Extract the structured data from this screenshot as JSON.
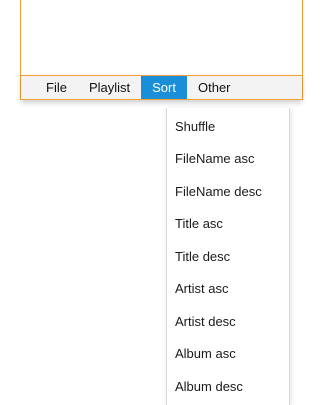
{
  "menubar": {
    "items": [
      {
        "label": "File"
      },
      {
        "label": "Playlist"
      },
      {
        "label": "Sort"
      },
      {
        "label": "Other"
      }
    ],
    "active_index": 2
  },
  "sort_menu": {
    "items": [
      {
        "label": "Shuffle"
      },
      {
        "label": "FileName asc"
      },
      {
        "label": "FileName desc"
      },
      {
        "label": "Title asc"
      },
      {
        "label": "Title desc"
      },
      {
        "label": "Artist asc"
      },
      {
        "label": "Artist desc"
      },
      {
        "label": "Album asc"
      },
      {
        "label": "Album desc"
      }
    ]
  },
  "colors": {
    "accent_border": "#f0a030",
    "menu_active_bg": "#1a8fd8",
    "menu_active_text": "#ffffff",
    "menubar_bg": "#f3f3f3"
  }
}
